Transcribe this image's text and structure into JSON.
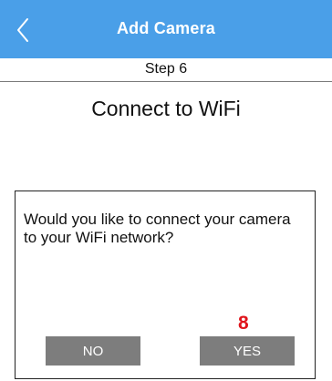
{
  "header": {
    "title": "Add Camera",
    "back_icon": "chevron-left-icon",
    "background_color": "#4a9fe8"
  },
  "step": {
    "label": "Step 6"
  },
  "page": {
    "heading": "Connect to WiFi"
  },
  "dialog": {
    "message": "Would you like to connect your camera to your WiFi network?",
    "annotation": "8",
    "annotation_color": "#e0151c",
    "no_label": "NO",
    "yes_label": "YES",
    "button_color": "#7d7d7d"
  }
}
